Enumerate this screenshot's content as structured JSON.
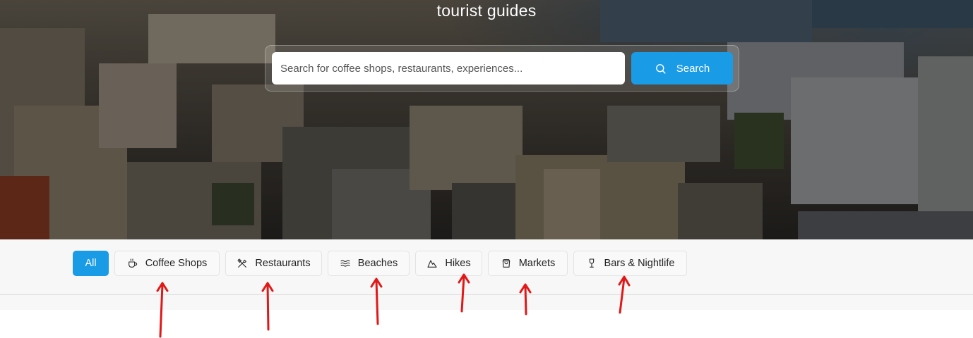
{
  "hero": {
    "title": "tourist guides"
  },
  "search": {
    "placeholder": "Search for coffee shops, restaurants, experiences...",
    "button_label": "Search",
    "button_icon": "search-icon"
  },
  "categories": [
    {
      "label": "All",
      "icon": null,
      "active": true
    },
    {
      "label": "Coffee Shops",
      "icon": "coffee-cup-icon",
      "active": false
    },
    {
      "label": "Restaurants",
      "icon": "utensils-crossed-icon",
      "active": false
    },
    {
      "label": "Beaches",
      "icon": "waves-icon",
      "active": false
    },
    {
      "label": "Hikes",
      "icon": "mountain-icon",
      "active": false
    },
    {
      "label": "Markets",
      "icon": "shopping-bag-icon",
      "active": false
    },
    {
      "label": "Bars & Nightlife",
      "icon": "wine-glass-icon",
      "active": false
    }
  ],
  "colors": {
    "accent": "#1a9be6",
    "annotation_arrow": "#e01818"
  }
}
